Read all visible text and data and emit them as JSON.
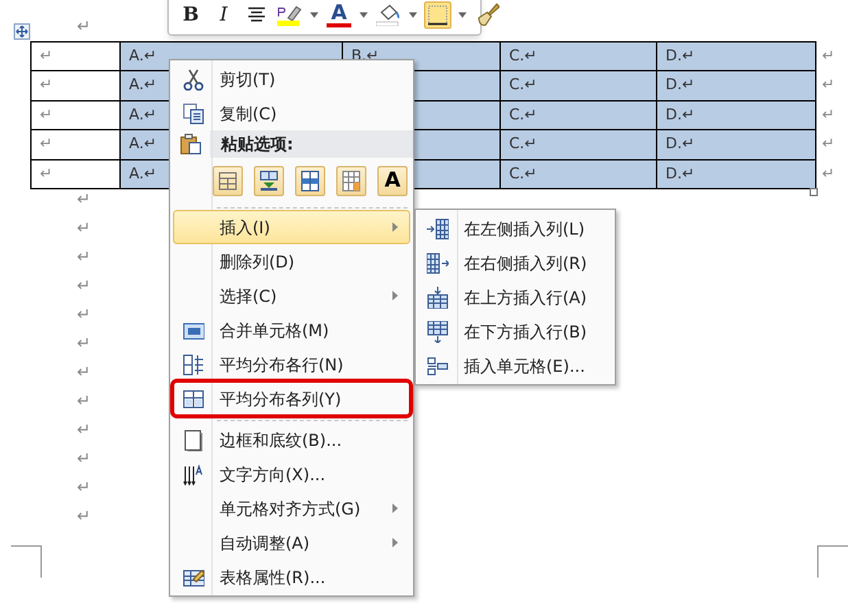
{
  "document": {
    "marks_before": [
      "↵"
    ],
    "marks_after": [
      "↵",
      "↵",
      "↵",
      "↵",
      "↵",
      "↵",
      "↵",
      "↵",
      "↵",
      "↵",
      "↵",
      "↵"
    ]
  },
  "table": {
    "column_selection": [
      false,
      true,
      true,
      true,
      true
    ],
    "rows": [
      {
        "c1": "↵",
        "c2": "A.↵",
        "c3": "B.↵",
        "c4": "C.↵",
        "c5": "D.↵",
        "end": "↵"
      },
      {
        "c1": "↵",
        "c2": "A.↵",
        "c4": "C.↵",
        "c5": "D.↵",
        "end": "↵"
      },
      {
        "c1": "↵",
        "c2": "A.↵",
        "c4": "C.↵",
        "c5": "D.↵",
        "end": "↵"
      },
      {
        "c1": "↵",
        "c2": "A.↵",
        "c4": "C.↵",
        "c5": "D.↵",
        "end": "↵"
      },
      {
        "c1": "↵",
        "c2": "A.↵",
        "c4": "C.↵",
        "c5": "D.↵",
        "end": "↵"
      }
    ]
  },
  "mini_toolbar": {
    "buttons": [
      {
        "kind": "bold",
        "label": "B",
        "selected": false
      },
      {
        "kind": "italic",
        "label": "I",
        "selected": false
      },
      {
        "kind": "align",
        "selected": false
      },
      {
        "kind": "highlight",
        "selected": false
      },
      {
        "kind": "dropdown",
        "selected": false
      },
      {
        "kind": "font_color",
        "label": "A",
        "selected": false
      },
      {
        "kind": "dropdown",
        "selected": false
      },
      {
        "kind": "shading",
        "selected": false
      },
      {
        "kind": "dropdown",
        "selected": false
      },
      {
        "kind": "borders",
        "selected": true
      },
      {
        "kind": "dropdown",
        "selected": false
      },
      {
        "kind": "painter",
        "selected": false
      }
    ]
  },
  "context_menu": {
    "items": [
      {
        "kind": "item",
        "label": "剪切(T)",
        "submenu": false,
        "selected": false,
        "annotated": false
      },
      {
        "kind": "item",
        "label": "复制(C)",
        "submenu": false,
        "selected": false,
        "annotated": false
      },
      {
        "kind": "header",
        "label": "粘贴选项:"
      },
      {
        "kind": "paste_options",
        "options": [
          {
            "kind": "nested"
          },
          {
            "kind": "merge"
          },
          {
            "kind": "rows"
          },
          {
            "kind": "values"
          },
          {
            "kind": "text",
            "label": "A"
          }
        ]
      },
      {
        "kind": "separator"
      },
      {
        "kind": "item",
        "label": "插入(I)",
        "submenu": true,
        "selected": true,
        "annotated": false
      },
      {
        "kind": "item",
        "label": "删除列(D)",
        "submenu": false,
        "selected": false,
        "annotated": false
      },
      {
        "kind": "item",
        "label": "选择(C)",
        "submenu": true,
        "selected": false,
        "annotated": false
      },
      {
        "kind": "item",
        "label": "合并单元格(M)",
        "submenu": false,
        "selected": false,
        "annotated": false
      },
      {
        "kind": "item",
        "label": "平均分布各行(N)",
        "submenu": false,
        "selected": false,
        "annotated": false
      },
      {
        "kind": "item",
        "label": "平均分布各列(Y)",
        "submenu": false,
        "selected": false,
        "annotated": true
      },
      {
        "kind": "separator"
      },
      {
        "kind": "item",
        "label": "边框和底纹(B)...",
        "submenu": false,
        "selected": false,
        "annotated": false
      },
      {
        "kind": "item",
        "label": "文字方向(X)...",
        "submenu": false,
        "selected": false,
        "annotated": false
      },
      {
        "kind": "item",
        "label": "单元格对齐方式(G)",
        "submenu": true,
        "selected": false,
        "annotated": false
      },
      {
        "kind": "item",
        "label": "自动调整(A)",
        "submenu": true,
        "selected": false,
        "annotated": false
      },
      {
        "kind": "item",
        "label": "表格属性(R)...",
        "submenu": false,
        "selected": false,
        "annotated": false
      }
    ]
  },
  "submenu": {
    "items": [
      {
        "label": "在左侧插入列(L)"
      },
      {
        "label": "在右侧插入列(R)"
      },
      {
        "label": "在上方插入行(A)"
      },
      {
        "label": "在下方插入行(B)"
      },
      {
        "label": "插入单元格(E)..."
      }
    ]
  }
}
